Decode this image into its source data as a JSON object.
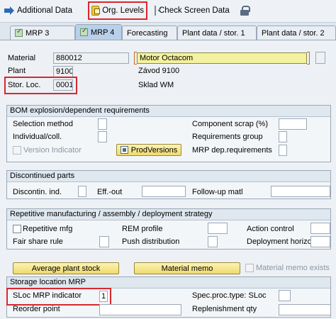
{
  "toolbar": {
    "additional_data": "Additional Data",
    "org_levels": "Org. Levels",
    "check_screen_data": "Check Screen Data"
  },
  "tabs": [
    "MRP 3",
    "MRP 4",
    "Forecasting",
    "Plant data / stor. 1",
    "Plant data / stor. 2"
  ],
  "header": {
    "material_label": "Material",
    "material_value": "880012",
    "material_desc": "Motor Octacom",
    "plant_label": "Plant",
    "plant_value": "9100",
    "plant_desc": "Závod 9100",
    "sloc_label": "Stor. Loc.",
    "sloc_value": "0001",
    "sloc_desc": "Sklad WM"
  },
  "bom": {
    "title": "BOM explosion/dependent requirements",
    "selection_method": "Selection method",
    "individual_coll": "Individual/coll.",
    "version_indicator": "Version Indicator",
    "prod_versions": "ProdVersions",
    "component_scrap": "Component scrap (%)",
    "requirements_group": "Requirements group",
    "mrp_dep_requirements": "MRP dep.requirements"
  },
  "discontinued": {
    "title": "Discontinued parts",
    "discontin_ind": "Discontin. ind.",
    "eff_out": "Eff.-out",
    "followup_matl": "Follow-up matl"
  },
  "repetitive": {
    "title": "Repetitive manufacturing / assembly / deployment strategy",
    "repetitive_mfg": "Repetitive mfg",
    "rem_profile": "REM profile",
    "action_control": "Action control",
    "fair_share_rule": "Fair share rule",
    "push_distribution": "Push distribution",
    "deployment_horizon": "Deployment horizon"
  },
  "buttons": {
    "average_plant_stock": "Average plant stock",
    "material_memo": "Material memo",
    "material_memo_exists": "Material memo exists"
  },
  "storage_mrp": {
    "title": "Storage location MRP",
    "sloc_mrp_indicator": "SLoc MRP indicator",
    "sloc_mrp_value": "1",
    "spec_proc_type": "Spec.proc.type: SLoc",
    "reorder_point": "Reorder point",
    "replenishment_qty": "Replenishment qty"
  }
}
